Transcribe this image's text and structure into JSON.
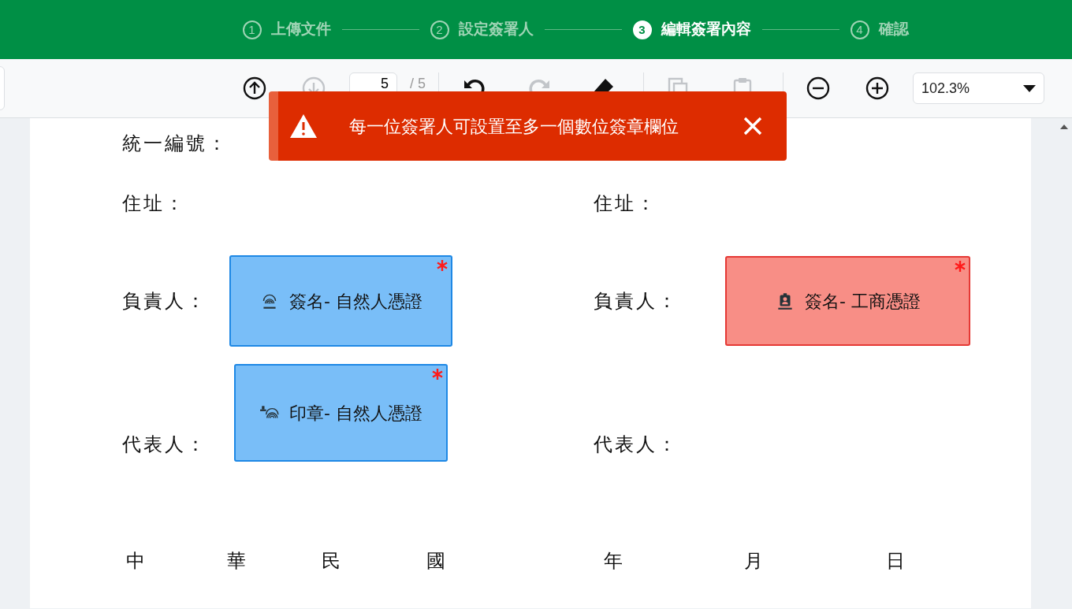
{
  "steps": [
    {
      "number": "1",
      "label": "上傳文件",
      "selected": false
    },
    {
      "number": "2",
      "label": "設定簽署人",
      "selected": false
    },
    {
      "number": "3",
      "label": "編輯簽署內容",
      "selected": true
    },
    {
      "number": "4",
      "label": "確認",
      "selected": false
    }
  ],
  "toolbar": {
    "nav_buttons": [
      {
        "kind": "up",
        "disabled": false
      },
      {
        "kind": "down",
        "disabled": true
      }
    ],
    "page_field": {
      "value": "5"
    },
    "page_total": "/ 5",
    "edit_buttons": [
      {
        "kind": "undo",
        "disabled": false
      },
      {
        "kind": "redo",
        "disabled": true
      },
      {
        "kind": "eraser",
        "disabled": false
      }
    ],
    "clipboard_buttons": [
      {
        "kind": "copy",
        "disabled": true
      },
      {
        "kind": "paste",
        "disabled": true
      }
    ],
    "zoom_buttons": [
      {
        "kind": "zoom-out",
        "disabled": false
      },
      {
        "kind": "zoom-in",
        "disabled": false
      }
    ],
    "zoom_select": {
      "value": "102.3%"
    }
  },
  "toast": {
    "message": "每一位簽署人可設置至多一個數位簽章欄位"
  },
  "document": {
    "rows": [
      {
        "left": {
          "label": "統一編號："
        }
      },
      {
        "left": {
          "label": "住址："
        },
        "right": {
          "label": "住址："
        }
      },
      {
        "left": {
          "label": "負責人：",
          "field": {
            "kind": "natural-signature",
            "text": "簽名- 自然人憑證",
            "color": "#79bef8",
            "required": true
          }
        },
        "right": {
          "label": "負責人：",
          "field": {
            "kind": "business-signature",
            "text": "簽名- 工商憑證",
            "color": "#f88e86",
            "required": true
          }
        }
      },
      {
        "left": {
          "label": "代表人：",
          "field": {
            "kind": "natural-stamp",
            "text": "印章- 自然人憑證",
            "color": "#79bef8",
            "required": true
          }
        },
        "right": {
          "label": "代表人："
        }
      }
    ],
    "date_left": [
      "中",
      "華",
      "民",
      "國"
    ],
    "date_right": [
      "年",
      "月",
      "日"
    ]
  }
}
